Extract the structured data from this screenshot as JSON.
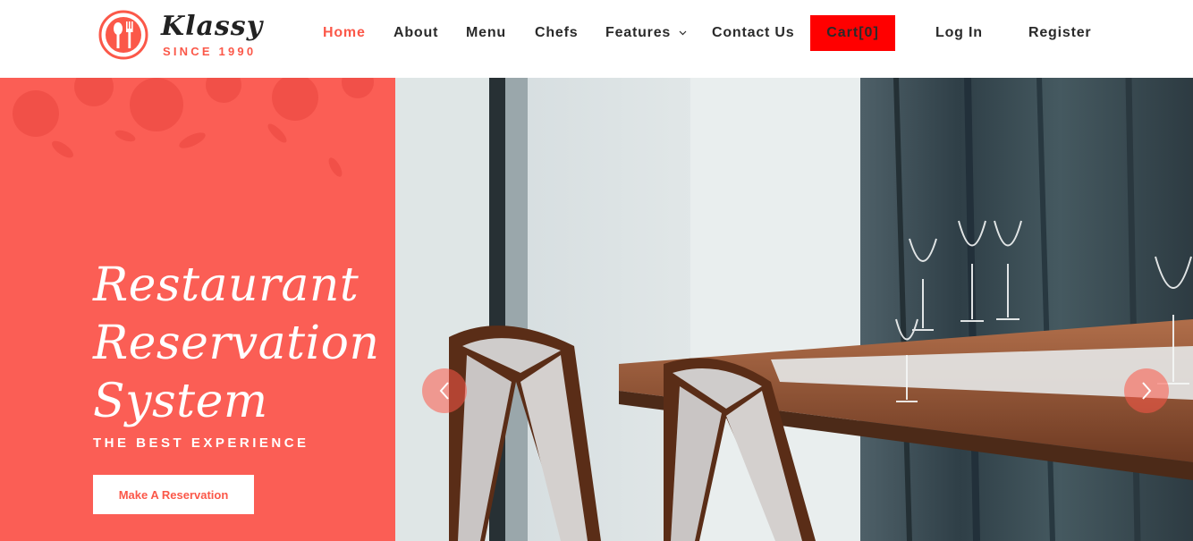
{
  "brand": {
    "name": "Klassy",
    "tagline": "SINCE 1990",
    "accent": "#fb5849"
  },
  "nav": {
    "items": [
      {
        "label": "Home",
        "active": true
      },
      {
        "label": "About"
      },
      {
        "label": "Menu"
      },
      {
        "label": "Chefs"
      },
      {
        "label": "Features",
        "has_dropdown": true
      },
      {
        "label": "Contact Us"
      }
    ],
    "cart_label": "Cart",
    "cart_count": "[0]",
    "login": "Log In",
    "register": "Register"
  },
  "hero": {
    "title_lines": [
      "Restaurant",
      "Reservation",
      "System"
    ],
    "subtitle": "THE BEST EXPERIENCE",
    "cta": "Make A Reservation",
    "panel_color": "#fb5e55"
  },
  "slider": {
    "prev_icon": "chevron-left-icon",
    "next_icon": "chevron-right-icon"
  }
}
